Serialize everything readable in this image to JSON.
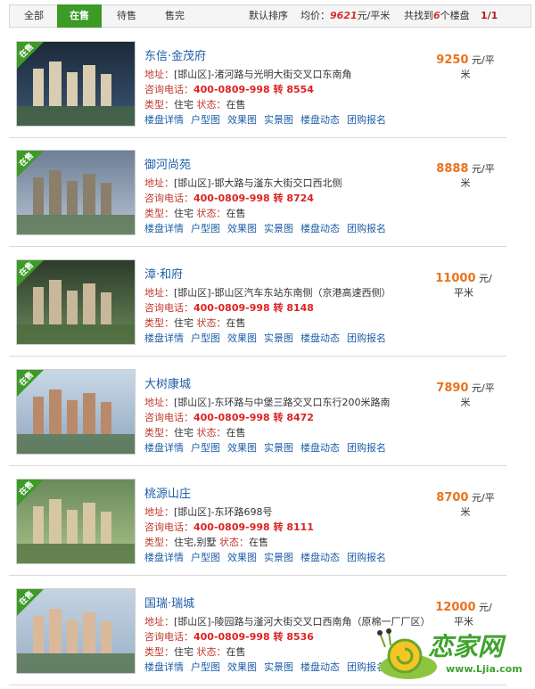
{
  "tabs": [
    {
      "label": "全部",
      "active": false
    },
    {
      "label": "在售",
      "active": true
    },
    {
      "label": "待售",
      "active": false
    },
    {
      "label": "售完",
      "active": false
    }
  ],
  "sortbar": {
    "sort_label": "默认排序",
    "avg_prefix": "均价：",
    "avg_value": "9621",
    "avg_unit": "元/平米",
    "found_prefix": "共找到",
    "found_count": "6",
    "found_suffix": "个楼盘",
    "pager": "1/1"
  },
  "labels": {
    "address": "地址：",
    "phone": "咨询电话：",
    "type": "类型：",
    "status": "状态："
  },
  "link_labels": [
    "楼盘详情",
    "户型图",
    "效果图",
    "实景图",
    "楼盘动态",
    "团购报名"
  ],
  "badge": "在售",
  "properties": [
    {
      "name": "东信·金茂府",
      "address": "[邯山区]-渚河路与光明大街交叉口东南角",
      "phone": "400-0809-998 转 8554",
      "type": "住宅",
      "status": "在售",
      "price": "9250",
      "price_unit_1": "元/平",
      "price_unit_2": "米"
    },
    {
      "name": "御河尚苑",
      "address": "[邯山区]-邯大路与滏东大街交口西北侧",
      "phone": "400-0809-998 转 8724",
      "type": "住宅",
      "status": "在售",
      "price": "8888",
      "price_unit_1": "元/平",
      "price_unit_2": "米"
    },
    {
      "name": "漳·和府",
      "address": "[邯山区]-邯山区汽车东站东南侧（京港高速西侧）",
      "phone": "400-0809-998 转 8148",
      "type": "住宅",
      "status": "在售",
      "price": "11000",
      "price_unit_1": "元/",
      "price_unit_2": "平米"
    },
    {
      "name": "大树康城",
      "address": "[邯山区]-东环路与中堡三路交叉口东行200米路南",
      "phone": "400-0809-998 转 8472",
      "type": "住宅",
      "status": "在售",
      "price": "7890",
      "price_unit_1": "元/平",
      "price_unit_2": "米"
    },
    {
      "name": "桃源山庄",
      "address": "[邯山区]-东环路698号",
      "phone": "400-0809-998 转 8111",
      "type": "住宅,别墅",
      "status": "在售",
      "price": "8700",
      "price_unit_1": "元/平",
      "price_unit_2": "米"
    },
    {
      "name": "国瑞·瑞城",
      "address": "[邯山区]-陵园路与滏河大街交叉口西南角（原棉一厂厂区）",
      "phone": "400-0809-998 转 8536",
      "type": "住宅",
      "status": "在售",
      "price": "12000",
      "price_unit_1": "元/",
      "price_unit_2": "平米"
    }
  ],
  "watermark": {
    "brand": "恋家网",
    "url": "www.Ljia.com"
  },
  "colors": {
    "accent_green": "#3c9a26",
    "link_blue": "#1e5ea8",
    "price_orange": "#e8741e",
    "label_red": "#c0392b"
  }
}
